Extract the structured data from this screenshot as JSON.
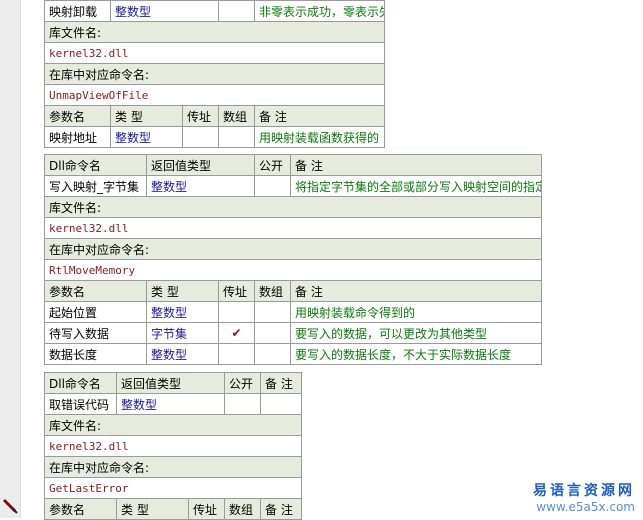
{
  "block1": {
    "head_row": {
      "name": "映射卸载",
      "ret_type": "整数型",
      "public": "",
      "note": "非零表示成功，零表示失败"
    },
    "lib_label": "库文件名:",
    "lib_value": "kernel32.dll",
    "cmd_label": "在库中对应命令名:",
    "cmd_value": "UnmapViewOfFile",
    "param_headers": [
      "参数名",
      "类 型",
      "传址",
      "数组",
      "备 注"
    ],
    "params": [
      {
        "name": "映射地址",
        "type": "整数型",
        "byref": "",
        "array": "",
        "note": "用映射装载函数获得的"
      }
    ]
  },
  "block2": {
    "headers": [
      "Dll命令名",
      "返回值类型",
      "公开",
      "备 注"
    ],
    "head_row": {
      "name": "写入映射_字节集",
      "ret_type": "整数型",
      "public": "",
      "note": "将指定字节集的全部或部分写入映射空间的指定位置"
    },
    "lib_label": "库文件名:",
    "lib_value": "kernel32.dll",
    "cmd_label": "在库中对应命令名:",
    "cmd_value": "RtlMoveMemory",
    "param_headers": [
      "参数名",
      "类 型",
      "传址",
      "数组",
      "备 注"
    ],
    "params": [
      {
        "name": "起始位置",
        "type": "整数型",
        "byref": "",
        "array": "",
        "note": "用映射装载命令得到的"
      },
      {
        "name": "待写入数据",
        "type": "字节集",
        "byref": "✔",
        "array": "",
        "note": "要写入的数据，可以更改为其他类型"
      },
      {
        "name": "数据长度",
        "type": "整数型",
        "byref": "",
        "array": "",
        "note": "要写入的数据长度，不大于实际数据长度"
      }
    ]
  },
  "block3": {
    "headers": [
      "Dll命令名",
      "返回值类型",
      "公开",
      "备 注"
    ],
    "head_row": {
      "name": "取错误代码",
      "ret_type": "整数型",
      "public": "",
      "note": ""
    },
    "lib_label": "库文件名:",
    "lib_value": "kernel32.dll",
    "cmd_label": "在库中对应命令名:",
    "cmd_value": "GetLastError",
    "param_headers": [
      "参数名",
      "类 型",
      "传址",
      "数组",
      "备 注"
    ]
  },
  "watermark": {
    "cn": "易语言资源网",
    "en": "www.e5a5x.com"
  },
  "colors": {
    "header_bg": "#e7ebdd",
    "type_text": "#1a1a9c",
    "note_text": "#0b7a0b",
    "mono_text": "#8b1a1a"
  }
}
